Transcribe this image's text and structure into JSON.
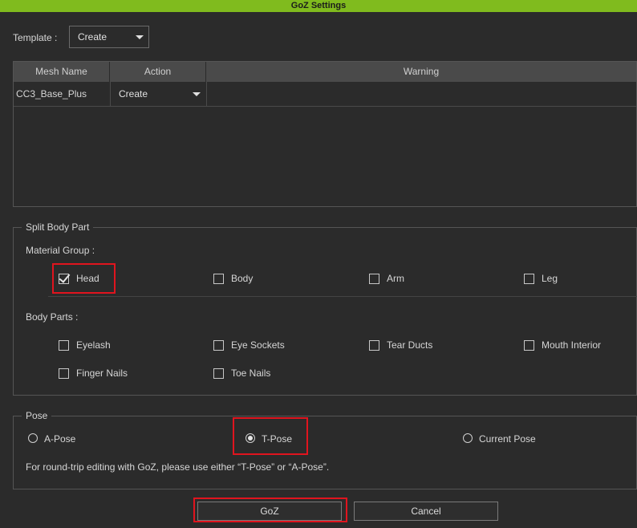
{
  "window": {
    "title": "GoZ Settings"
  },
  "template": {
    "label": "Template :",
    "value": "Create"
  },
  "mesh_table": {
    "columns": [
      "Mesh Name",
      "Action",
      "Warning"
    ],
    "rows": [
      {
        "mesh_name": "CC3_Base_Plus",
        "action": "Create",
        "warning": ""
      }
    ]
  },
  "split_body_part": {
    "legend": "Split Body Part",
    "material_group_label": "Material Group :",
    "material_groups": [
      {
        "label": "Head",
        "checked": true
      },
      {
        "label": "Body",
        "checked": false
      },
      {
        "label": "Arm",
        "checked": false
      },
      {
        "label": "Leg",
        "checked": false
      }
    ],
    "body_parts_label": "Body Parts :",
    "body_parts": [
      {
        "label": "Eyelash",
        "checked": false
      },
      {
        "label": "Eye Sockets",
        "checked": false
      },
      {
        "label": "Tear Ducts",
        "checked": false
      },
      {
        "label": "Mouth Interior",
        "checked": false
      },
      {
        "label": "Finger Nails",
        "checked": false
      },
      {
        "label": "Toe Nails",
        "checked": false
      }
    ]
  },
  "pose": {
    "legend": "Pose",
    "options": [
      {
        "label": "A-Pose",
        "selected": false
      },
      {
        "label": "T-Pose",
        "selected": true
      },
      {
        "label": "Current Pose",
        "selected": false
      }
    ],
    "note": "For round-trip editing with GoZ, please use either “T-Pose” or “A-Pose”."
  },
  "buttons": {
    "goz": "GoZ",
    "cancel": "Cancel"
  },
  "colors": {
    "title_bar": "#80bb1e",
    "background": "#2b2b2b",
    "highlight": "#e0141e"
  }
}
